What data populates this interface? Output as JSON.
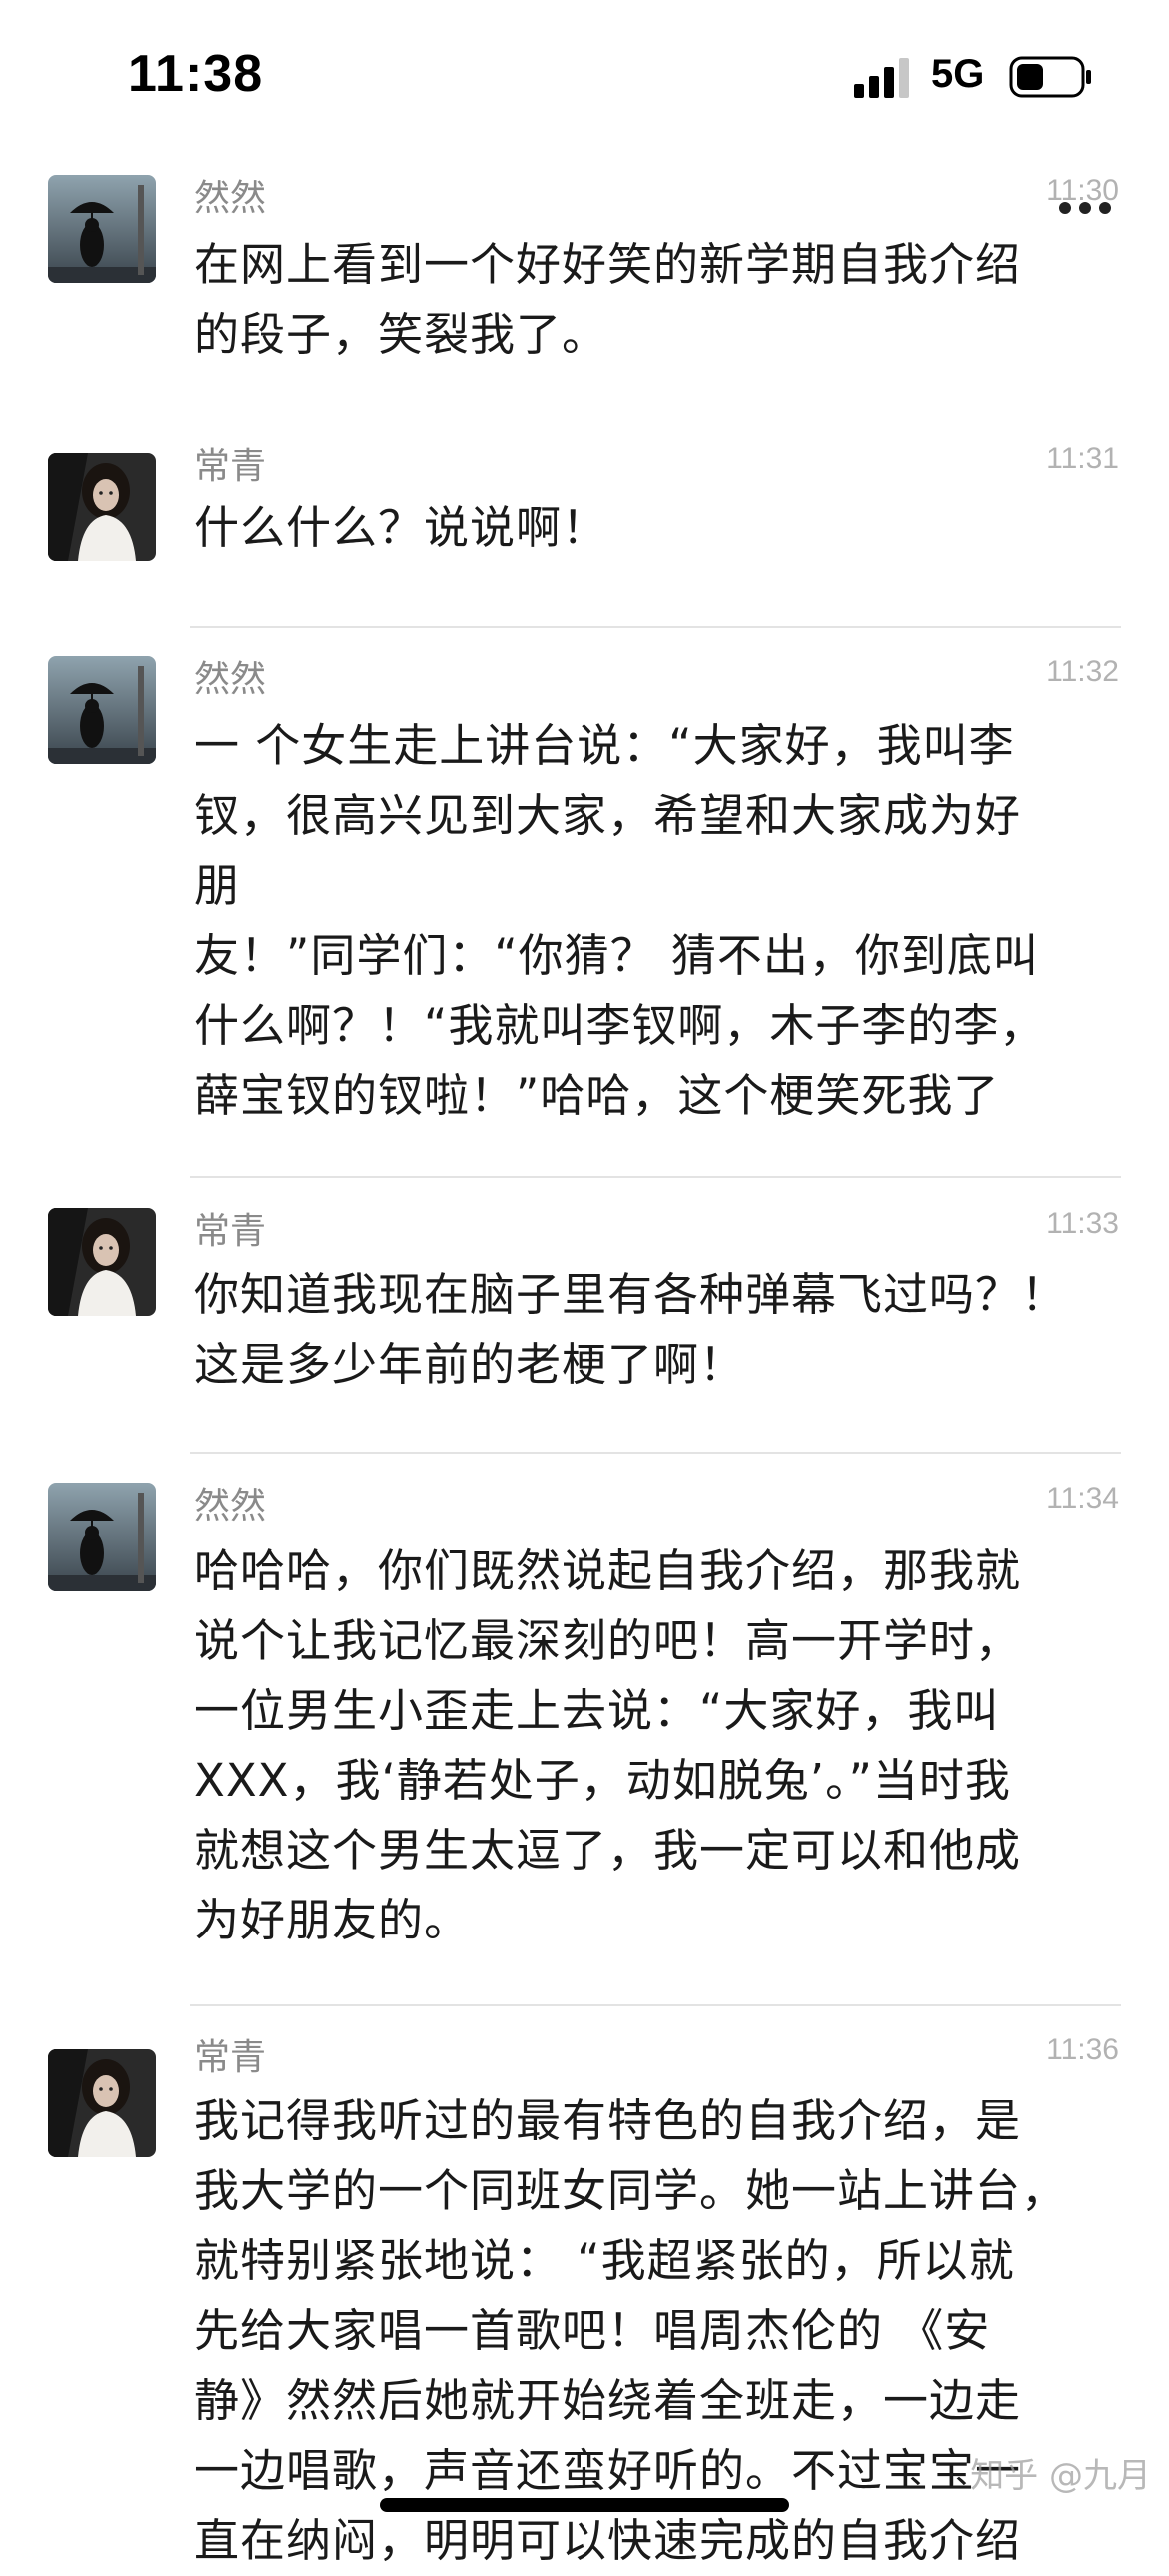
{
  "status_bar": {
    "time": "11:38",
    "network": "5G",
    "signal_icon": "signal-bars-icon",
    "battery_icon": "battery-icon"
  },
  "more_icon": "more-dots-icon",
  "messages": [
    {
      "sender": "然然",
      "avatar": "avatar-umbrella-silhouette",
      "time": "11:30",
      "text": "在网上看到一个好好笑的新学期自我介绍\n的段子，笑裂我了。"
    },
    {
      "sender": "常青",
      "avatar": "avatar-girl-portrait",
      "time": "11:31",
      "text": "什么什么？说说啊！"
    },
    {
      "sender": "然然",
      "avatar": "avatar-umbrella-silhouette",
      "time": "11:32",
      "text": "一 个女生走上讲台说：“大家好，我叫李\n钗，很高兴见到大家，希望和大家成为好\n朋\n友！”同学们：“你猜？ 猜不出，你到底叫\n什么啊？！“我就叫李钗啊，木子李的李，\n薛宝钗的钗啦！”哈哈，这个梗笑死我了"
    },
    {
      "sender": "常青",
      "avatar": "avatar-girl-portrait",
      "time": "11:33",
      "text": "你知道我现在脑子里有各种弹幕飞过吗？！\n这是多少年前的老梗了啊！"
    },
    {
      "sender": "然然",
      "avatar": "avatar-umbrella-silhouette",
      "time": "11:34",
      "text": "哈哈哈，你们既然说起自我介绍，那我就\n说个让我记忆最深刻的吧！高一开学时，\n一位男生小歪走上去说：“大家好，我叫\nXXX，我‘静若处子，动如脱兔’。”当时我\n就想这个男生太逗了，我一定可以和他成\n为好朋友的。"
    },
    {
      "sender": "常青",
      "avatar": "avatar-girl-portrait",
      "time": "11:36",
      "text": "我记得我听过的最有特色的自我介绍，是\n我大学的一个同班女同学。她一站上讲台，\n就特别紧张地说： “我超紧张的，所以就\n先给大家唱一首歌吧！唱周杰伦的 《安\n静》然然后她就开始绕着全班走，一边走\n一边唱歌，声音还蛮好听的。不过宝宝一\n直在纳闷，明明可以快速完成的自我介绍"
    }
  ],
  "watermark": "知乎 @九月"
}
